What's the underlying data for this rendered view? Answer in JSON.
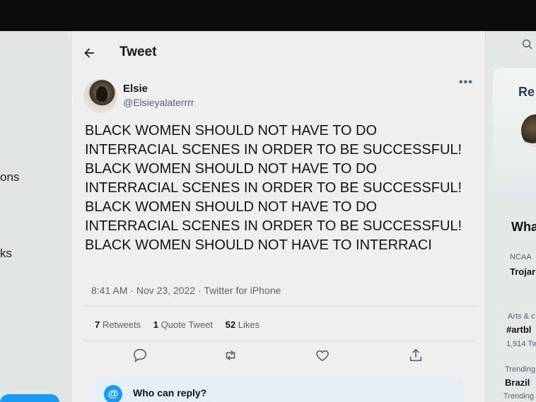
{
  "left_nav": {
    "items": [
      "ons",
      "ks"
    ]
  },
  "header": {
    "title": "Tweet"
  },
  "tweet": {
    "author_name": "Elsie",
    "author_handle": "@Elsieyalaterrrr",
    "text": "BLACK WOMEN SHOULD NOT HAVE TO DO INTERRACIAL SCENES IN ORDER TO BE SUCCESSFUL! BLACK WOMEN SHOULD NOT HAVE TO DO INTERRACIAL SCENES IN ORDER TO BE SUCCESSFUL! BLACK WOMEN SHOULD NOT HAVE TO DO INTERRACIAL SCENES IN ORDER TO BE SUCCESSFUL! BLACK WOMEN SHOULD NOT HAVE TO INTERRACI",
    "time": "8:41 AM",
    "date": "Nov 23, 2022",
    "source": "Twitter for iPhone",
    "stats": {
      "retweets_count": "7",
      "retweets_label": "Retweets",
      "quotes_count": "1",
      "quotes_label": "Quote Tweet",
      "likes_count": "52",
      "likes_label": "Likes"
    }
  },
  "reply_restriction": {
    "label": "Who can reply?"
  },
  "right_sidebar": {
    "heading_top": "Re",
    "heading_mid": "Wha",
    "trends": [
      {
        "category": "NCAA",
        "name": "Trojar"
      },
      {
        "category": "Arts & c",
        "name": "#artbl",
        "count": "1,914 Tw"
      },
      {
        "category": "Trending",
        "name": "Brazil",
        "count": "Trending"
      }
    ]
  },
  "colors": {
    "accent": "#1d9bf0",
    "text_primary": "#0f1419",
    "text_secondary": "#536471"
  },
  "icons": [
    "back-arrow-icon",
    "more-icon",
    "reply-icon",
    "retweet-icon",
    "like-icon",
    "share-icon",
    "at-icon",
    "search-icon"
  ]
}
